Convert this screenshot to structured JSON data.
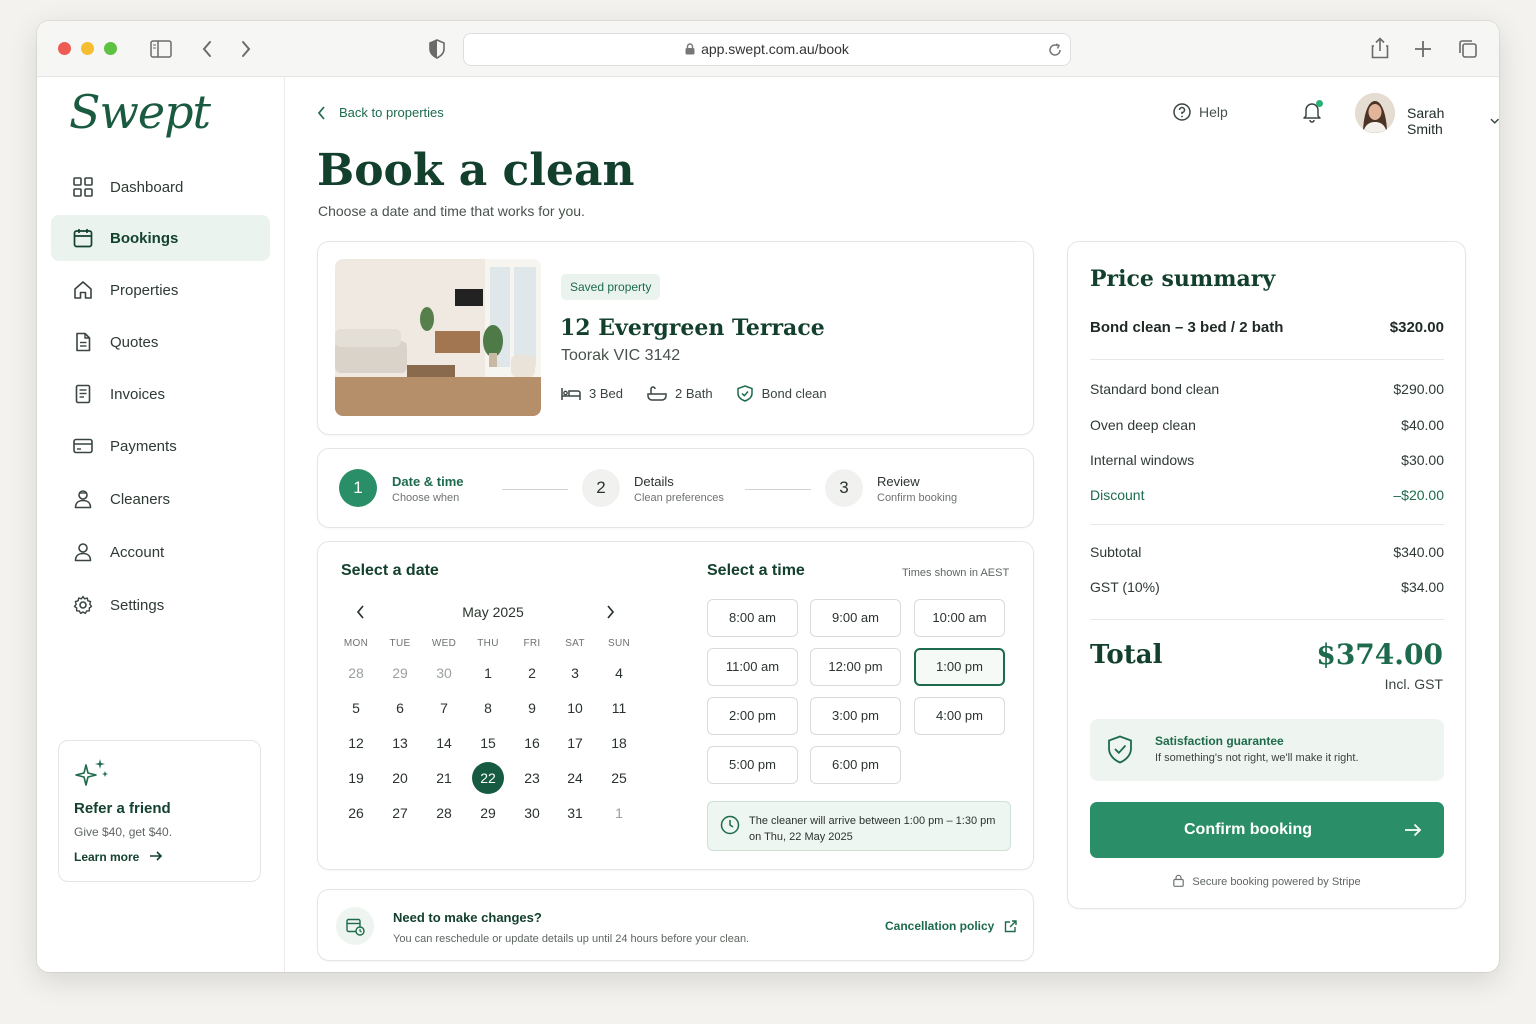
{
  "browser": {
    "url": "app.swept.com.au/book"
  },
  "brand": {
    "name": "Swept",
    "accent": "#1d6b4c",
    "button": "#2a8f68"
  },
  "sidebar": {
    "items": [
      {
        "label": "Dashboard",
        "icon": "grid-icon"
      },
      {
        "label": "Bookings",
        "icon": "calendar-icon",
        "active": true
      },
      {
        "label": "Properties",
        "icon": "home-icon"
      },
      {
        "label": "Quotes",
        "icon": "document-icon"
      },
      {
        "label": "Invoices",
        "icon": "receipt-icon"
      },
      {
        "label": "Payments",
        "icon": "card-icon"
      },
      {
        "label": "Cleaners",
        "icon": "people-icon"
      },
      {
        "label": "Account",
        "icon": "user-icon"
      },
      {
        "label": "Settings",
        "icon": "gear-icon"
      }
    ],
    "refer": {
      "title": "Refer a friend",
      "text": "Give $40, get $40.",
      "link": "Learn more"
    }
  },
  "header": {
    "back": "Back to properties",
    "help": "Help",
    "user": "Sarah Smith",
    "title": "Book a clean",
    "subtitle": "Choose a date and time that works for you."
  },
  "property": {
    "badge": "Saved property",
    "name": "12 Evergreen Terrace",
    "suburb": "Toorak VIC 3142",
    "beds": "3 Bed",
    "baths": "2 Bath",
    "type": "Bond clean"
  },
  "steps": [
    {
      "num": "1",
      "title": "Date & time",
      "sub": "Choose when"
    },
    {
      "num": "2",
      "title": "Details",
      "sub": "Clean preferences"
    },
    {
      "num": "3",
      "title": "Review",
      "sub": "Confirm booking"
    }
  ],
  "calendar": {
    "heading": "Select a date",
    "month": "May 2025",
    "weekdays": [
      "MON",
      "TUE",
      "WED",
      "THU",
      "FRI",
      "SAT",
      "SUN"
    ],
    "days": [
      [
        "28",
        "29",
        "30",
        "1",
        "2",
        "3",
        "4"
      ],
      [
        "5",
        "6",
        "7",
        "8",
        "9",
        "10",
        "11"
      ],
      [
        "12",
        "13",
        "14",
        "15",
        "16",
        "17",
        "18"
      ],
      [
        "19",
        "20",
        "21",
        "22",
        "23",
        "24",
        "25"
      ],
      [
        "26",
        "27",
        "28",
        "29",
        "30",
        "31",
        "1"
      ]
    ],
    "selected": "22"
  },
  "times": {
    "heading": "Select a time",
    "note": "Times shown in AEST",
    "slots": [
      "8:00 am",
      "9:00 am",
      "10:00 am",
      "11:00 am",
      "12:00 pm",
      "1:00 pm",
      "2:00 pm",
      "3:00 pm",
      "4:00 pm",
      "5:00 pm",
      "6:00 pm"
    ],
    "selected": "1:00 pm",
    "arrival_line1": "The cleaner will arrive between 1:00 pm – 1:30 pm",
    "arrival_line2": "on Thu, 22 May 2025"
  },
  "changes": {
    "title": "Need to make changes?",
    "text": "You can reschedule or update details up until 24 hours before your clean.",
    "link": "Cancellation policy"
  },
  "summary": {
    "title": "Price summary",
    "package_label": "Bond clean – 3 bed / 2 bath",
    "package_price": "$320.00",
    "lines": [
      {
        "label": "Standard bond clean",
        "value": "$290.00"
      },
      {
        "label": "Oven deep clean",
        "value": "$40.00"
      },
      {
        "label": "Internal windows",
        "value": "$30.00"
      },
      {
        "label": "Discount",
        "value": "–$20.00"
      }
    ],
    "subtotal_label": "Subtotal",
    "subtotal": "$340.00",
    "gst_label": "GST (10%)",
    "gst": "$34.00",
    "total_label": "Total",
    "total": "$374.00",
    "total_note": "Incl. GST",
    "guarantee_title": "Satisfaction guarantee",
    "guarantee_text": "If something's not right, we'll make it right.",
    "confirm": "Confirm booking",
    "secure": "Secure booking powered by Stripe"
  }
}
